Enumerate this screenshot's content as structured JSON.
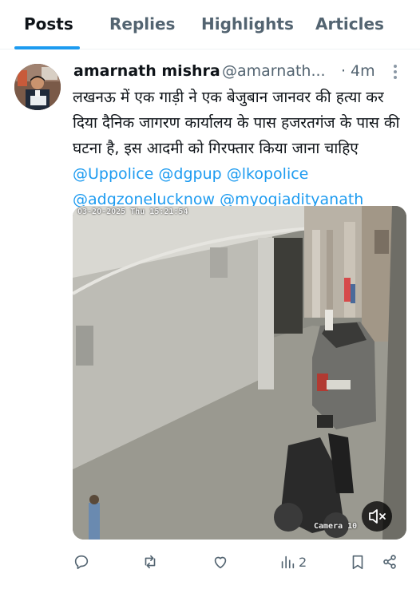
{
  "tabs": [
    {
      "label": "Posts",
      "active": true
    },
    {
      "label": "Replies",
      "active": false
    },
    {
      "label": "Highlights",
      "active": false
    },
    {
      "label": "Articles",
      "active": false
    }
  ],
  "tweet": {
    "display_name": "amarnath mishra",
    "handle": "@amarnath...",
    "dot": "·",
    "time": "4m",
    "text_plain": "लखनऊ में एक गाड़ी ने एक बेजुबान जानवर की हत्या कर दिया दैनिक जागरण कार्यालय के पास हजरतगंज के पास की घटना है, इस आदमी को गिरफ्तार किया जाना चाहिए",
    "mentions": [
      "@Uppolice",
      "@dgpup",
      "@lkopolice",
      "@adgzonelucknow",
      "@myogiadityanath"
    ],
    "media": {
      "timestamp": "03-20-2025 Thu 15:21:54",
      "camera_label": "Camera 10"
    },
    "actions": {
      "views_count": "2"
    }
  },
  "icons": {
    "more": "more-dots-icon",
    "reply": "reply-icon",
    "retweet": "retweet-icon",
    "like": "heart-icon",
    "views": "views-icon",
    "bookmark": "bookmark-icon",
    "share": "share-icon",
    "mute": "mute-icon"
  },
  "colors": {
    "accent": "#1d9bf0",
    "text": "#0f1419",
    "secondary": "#536471"
  }
}
